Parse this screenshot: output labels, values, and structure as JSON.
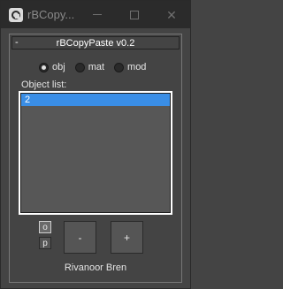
{
  "window": {
    "title": "rBCopy...",
    "minimize_icon": "minimize-icon",
    "maximize_icon": "maximize-icon",
    "close_icon": "close-icon",
    "close_glyph": "✕"
  },
  "rollout": {
    "collapse_symbol": "-",
    "title": "rBCopyPaste v0.2"
  },
  "mode": {
    "selected": "obj",
    "options": [
      {
        "label": "obj",
        "checked": true
      },
      {
        "label": "mat",
        "checked": false
      },
      {
        "label": "mod",
        "checked": false
      }
    ]
  },
  "object_list": {
    "label": "Object list:",
    "items": [
      {
        "label": "2",
        "selected": true
      }
    ]
  },
  "buttons": {
    "o_label": "o",
    "p_label": "p",
    "minus_label": "-",
    "plus_label": "+"
  },
  "footer": {
    "author": "Rivanoor Bren"
  },
  "colors": {
    "background": "#444444",
    "titlebar": "#2b2b2b",
    "selection": "#3a8ee6"
  }
}
